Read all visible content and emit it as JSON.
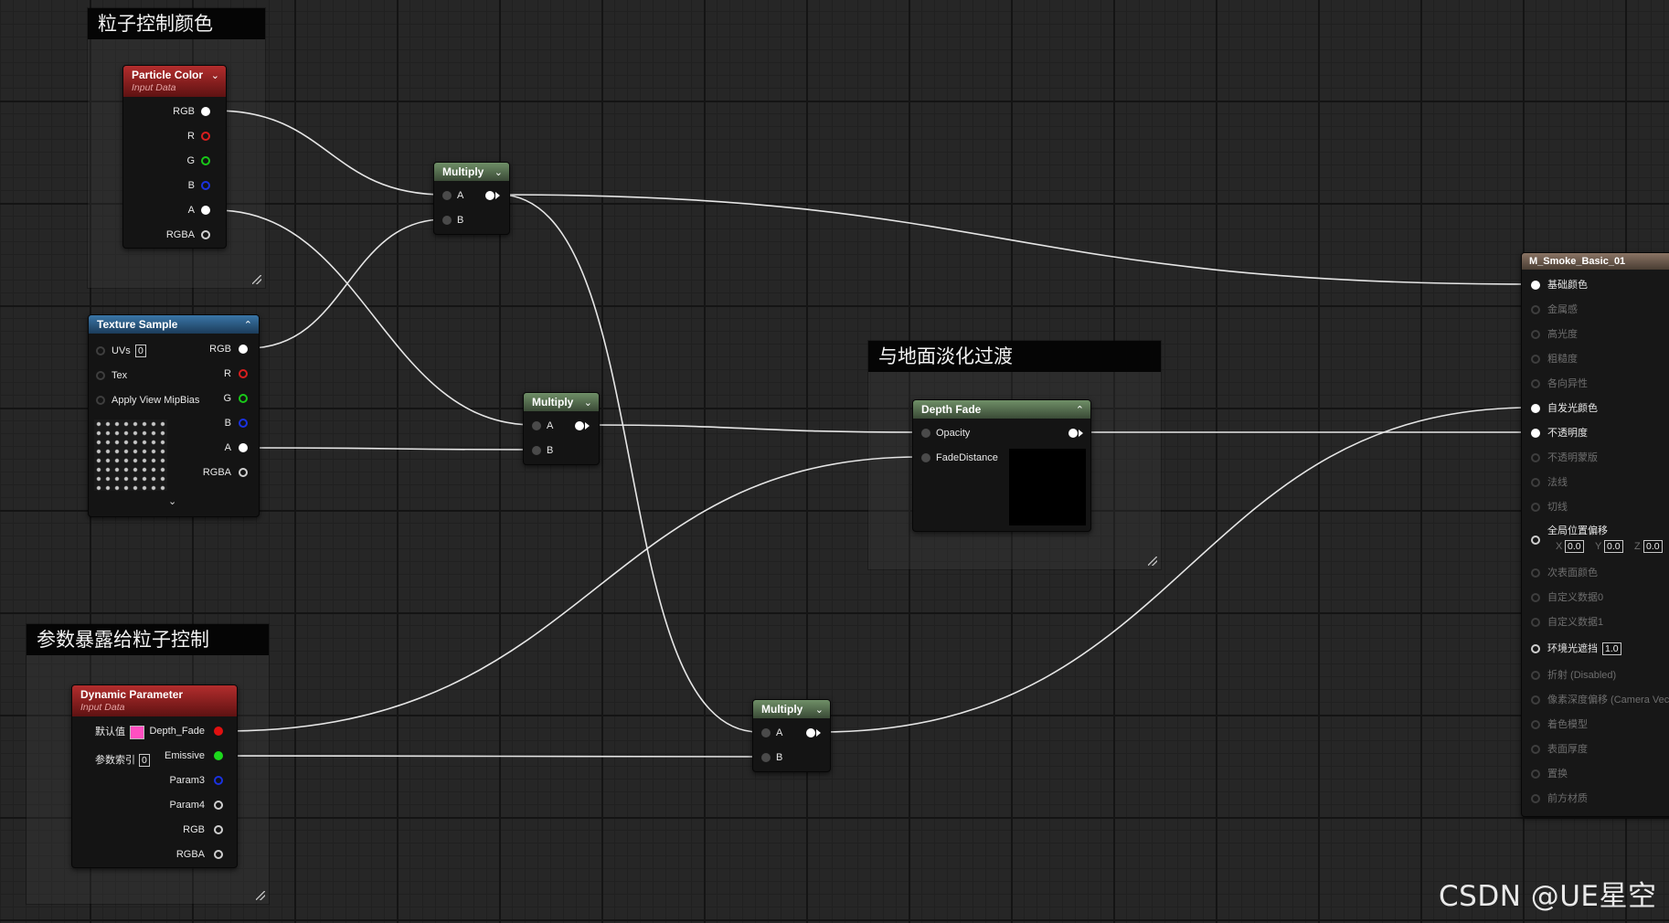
{
  "comments": [
    {
      "title": "粒子控制颜色"
    },
    {
      "title": "与地面淡化过渡"
    },
    {
      "title": "参数暴露给粒子控制"
    }
  ],
  "particle_color": {
    "title": "Particle Color",
    "subtitle": "Input Data",
    "outputs": [
      "RGB",
      "R",
      "G",
      "B",
      "A",
      "RGBA"
    ]
  },
  "texture_sample": {
    "title": "Texture Sample",
    "inputs": {
      "uvs": "UVs",
      "uvs_value": "0",
      "tex": "Tex",
      "mip": "Apply View MipBias"
    },
    "outputs": [
      "RGB",
      "R",
      "G",
      "B",
      "A",
      "RGBA"
    ]
  },
  "multiply1": {
    "title": "Multiply",
    "a": "A",
    "b": "B"
  },
  "multiply2": {
    "title": "Multiply",
    "a": "A",
    "b": "B"
  },
  "multiply3": {
    "title": "Multiply",
    "a": "A",
    "b": "B"
  },
  "depth_fade": {
    "title": "Depth Fade",
    "opacity": "Opacity",
    "fade_distance": "FadeDistance"
  },
  "dynamic_parameter": {
    "title": "Dynamic Parameter",
    "subtitle": "Input Data",
    "default_label": "默认值",
    "index_label": "参数索引",
    "index_value": "0",
    "outputs": [
      "Depth_Fade",
      "Emissive",
      "Param3",
      "Param4",
      "RGB",
      "RGBA"
    ]
  },
  "material": {
    "title": "M_Smoke_Basic_01",
    "inputs": [
      {
        "label": "基础颜色",
        "active": true
      },
      {
        "label": "金属感",
        "active": false
      },
      {
        "label": "高光度",
        "active": false
      },
      {
        "label": "粗糙度",
        "active": false
      },
      {
        "label": "各向异性",
        "active": false
      },
      {
        "label": "自发光颜色",
        "active": true
      },
      {
        "label": "不透明度",
        "active": true
      },
      {
        "label": "不透明蒙版",
        "active": false
      },
      {
        "label": "法线",
        "active": false
      },
      {
        "label": "切线",
        "active": false
      },
      {
        "label": "全局位置偏移",
        "active": true
      },
      {
        "label": "次表面颜色",
        "active": false
      },
      {
        "label": "自定义数据0",
        "active": false
      },
      {
        "label": "自定义数据1",
        "active": false
      },
      {
        "label": "环境光遮挡",
        "active": true
      },
      {
        "label": "折射 (Disabled)",
        "active": false
      },
      {
        "label": "像素深度偏移 (Camera Vec",
        "active": false
      },
      {
        "label": "着色模型",
        "active": false
      },
      {
        "label": "表面厚度",
        "active": false
      },
      {
        "label": "置换",
        "active": false
      },
      {
        "label": "前方材质",
        "active": false
      }
    ],
    "wpo": {
      "x_label": "X",
      "x": "0.0",
      "y_label": "Y",
      "y": "0.0",
      "z_label": "Z",
      "z": "0.0"
    },
    "ao_value": "1.0"
  },
  "watermark": "CSDN @UE星空",
  "colors": {
    "pin_red": "#d81e1e",
    "pin_green": "#19c819",
    "pin_blue": "#1a32e0",
    "default_swatch": "#ff4fc1"
  }
}
